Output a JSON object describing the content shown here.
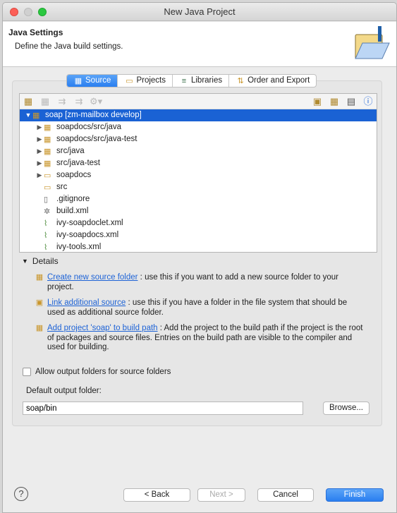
{
  "window": {
    "title": "New Java Project"
  },
  "header": {
    "title": "Java Settings",
    "subtitle": "Define the Java build settings."
  },
  "tabs": [
    {
      "label": "Source",
      "active": true,
      "icon": "source-folder-icon"
    },
    {
      "label": "Projects",
      "icon": "project-folder-icon"
    },
    {
      "label": "Libraries",
      "icon": "library-icon"
    },
    {
      "label": "Order and Export",
      "icon": "order-icon"
    }
  ],
  "tree": {
    "items": [
      {
        "label": "soap [zm-mailbox develop]",
        "expanded": true,
        "selected": true,
        "level": 0,
        "icon": "project-icon"
      },
      {
        "label": "soapdocs/src/java",
        "level": 1,
        "expandable": true,
        "icon": "package-folder-icon"
      },
      {
        "label": "soapdocs/src/java-test",
        "level": 1,
        "expandable": true,
        "icon": "package-folder-icon"
      },
      {
        "label": "src/java",
        "level": 1,
        "expandable": true,
        "icon": "package-folder-icon"
      },
      {
        "label": "src/java-test",
        "level": 1,
        "expandable": true,
        "icon": "package-folder-icon"
      },
      {
        "label": "soapdocs",
        "level": 1,
        "expandable": true,
        "icon": "folder-icon"
      },
      {
        "label": "src",
        "level": 1,
        "icon": "folder-icon"
      },
      {
        "label": ".gitignore",
        "level": 1,
        "icon": "file-icon"
      },
      {
        "label": "build.xml",
        "level": 1,
        "icon": "ant-file-icon"
      },
      {
        "label": "ivy-soapdoclet.xml",
        "level": 1,
        "icon": "xml-file-icon"
      },
      {
        "label": "ivy-soapdocs.xml",
        "level": 1,
        "icon": "xml-file-icon"
      },
      {
        "label": "ivy-tools.xml",
        "level": 1,
        "icon": "xml-file-icon"
      }
    ]
  },
  "details": {
    "title": "Details",
    "items": [
      {
        "link": "Create new source folder",
        "text": " : use this if you want to add a new source folder to your project."
      },
      {
        "link": "Link additional source",
        "text": " : use this if you have a folder in the file system that should be used as additional source folder."
      },
      {
        "link": "Add project 'soap' to build path",
        "text": " : Add the project to the build path if the project is the root of packages and source files. Entries on the build path are visible to the compiler and used for building."
      }
    ]
  },
  "allow_output": {
    "label": "Allow output folders for source folders",
    "checked": false
  },
  "output": {
    "label": "Default output folder:",
    "value": "soap/bin",
    "browse": "Browse..."
  },
  "footer": {
    "back": "< Back",
    "next": "Next >",
    "cancel": "Cancel",
    "finish": "Finish"
  },
  "colors": {
    "accent": "#2a7ff0",
    "selection": "#1a62d4",
    "link": "#1e63d6"
  }
}
